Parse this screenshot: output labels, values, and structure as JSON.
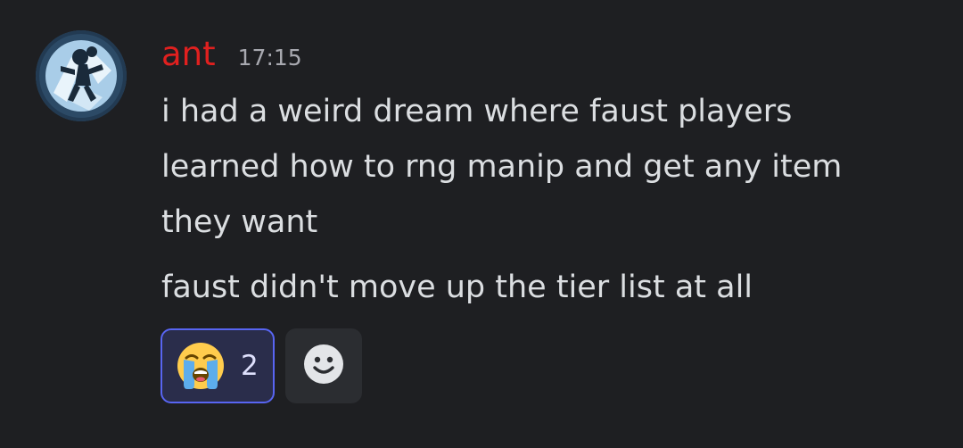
{
  "message": {
    "username": "ant",
    "timestamp": "17:15",
    "lines": [
      "i had a weird dream where faust players",
      "learned how to rng manip and get any item",
      "they want"
    ],
    "second_paragraph": "faust didn't move up the tier list at all"
  },
  "reactions": [
    {
      "emoji_icon": "loudly-crying-face",
      "count": "2",
      "selected": true
    }
  ],
  "colors": {
    "background": "#1e1f22",
    "username": "#e0201f",
    "text": "#dbdee1",
    "timestamp": "#a8a9b0",
    "reaction_selected_bg": "#2a2d4b",
    "reaction_selected_border": "#5865f2"
  },
  "icons": {
    "avatar": "avatar-image",
    "add_reaction": "add-reaction-smiley-icon"
  }
}
